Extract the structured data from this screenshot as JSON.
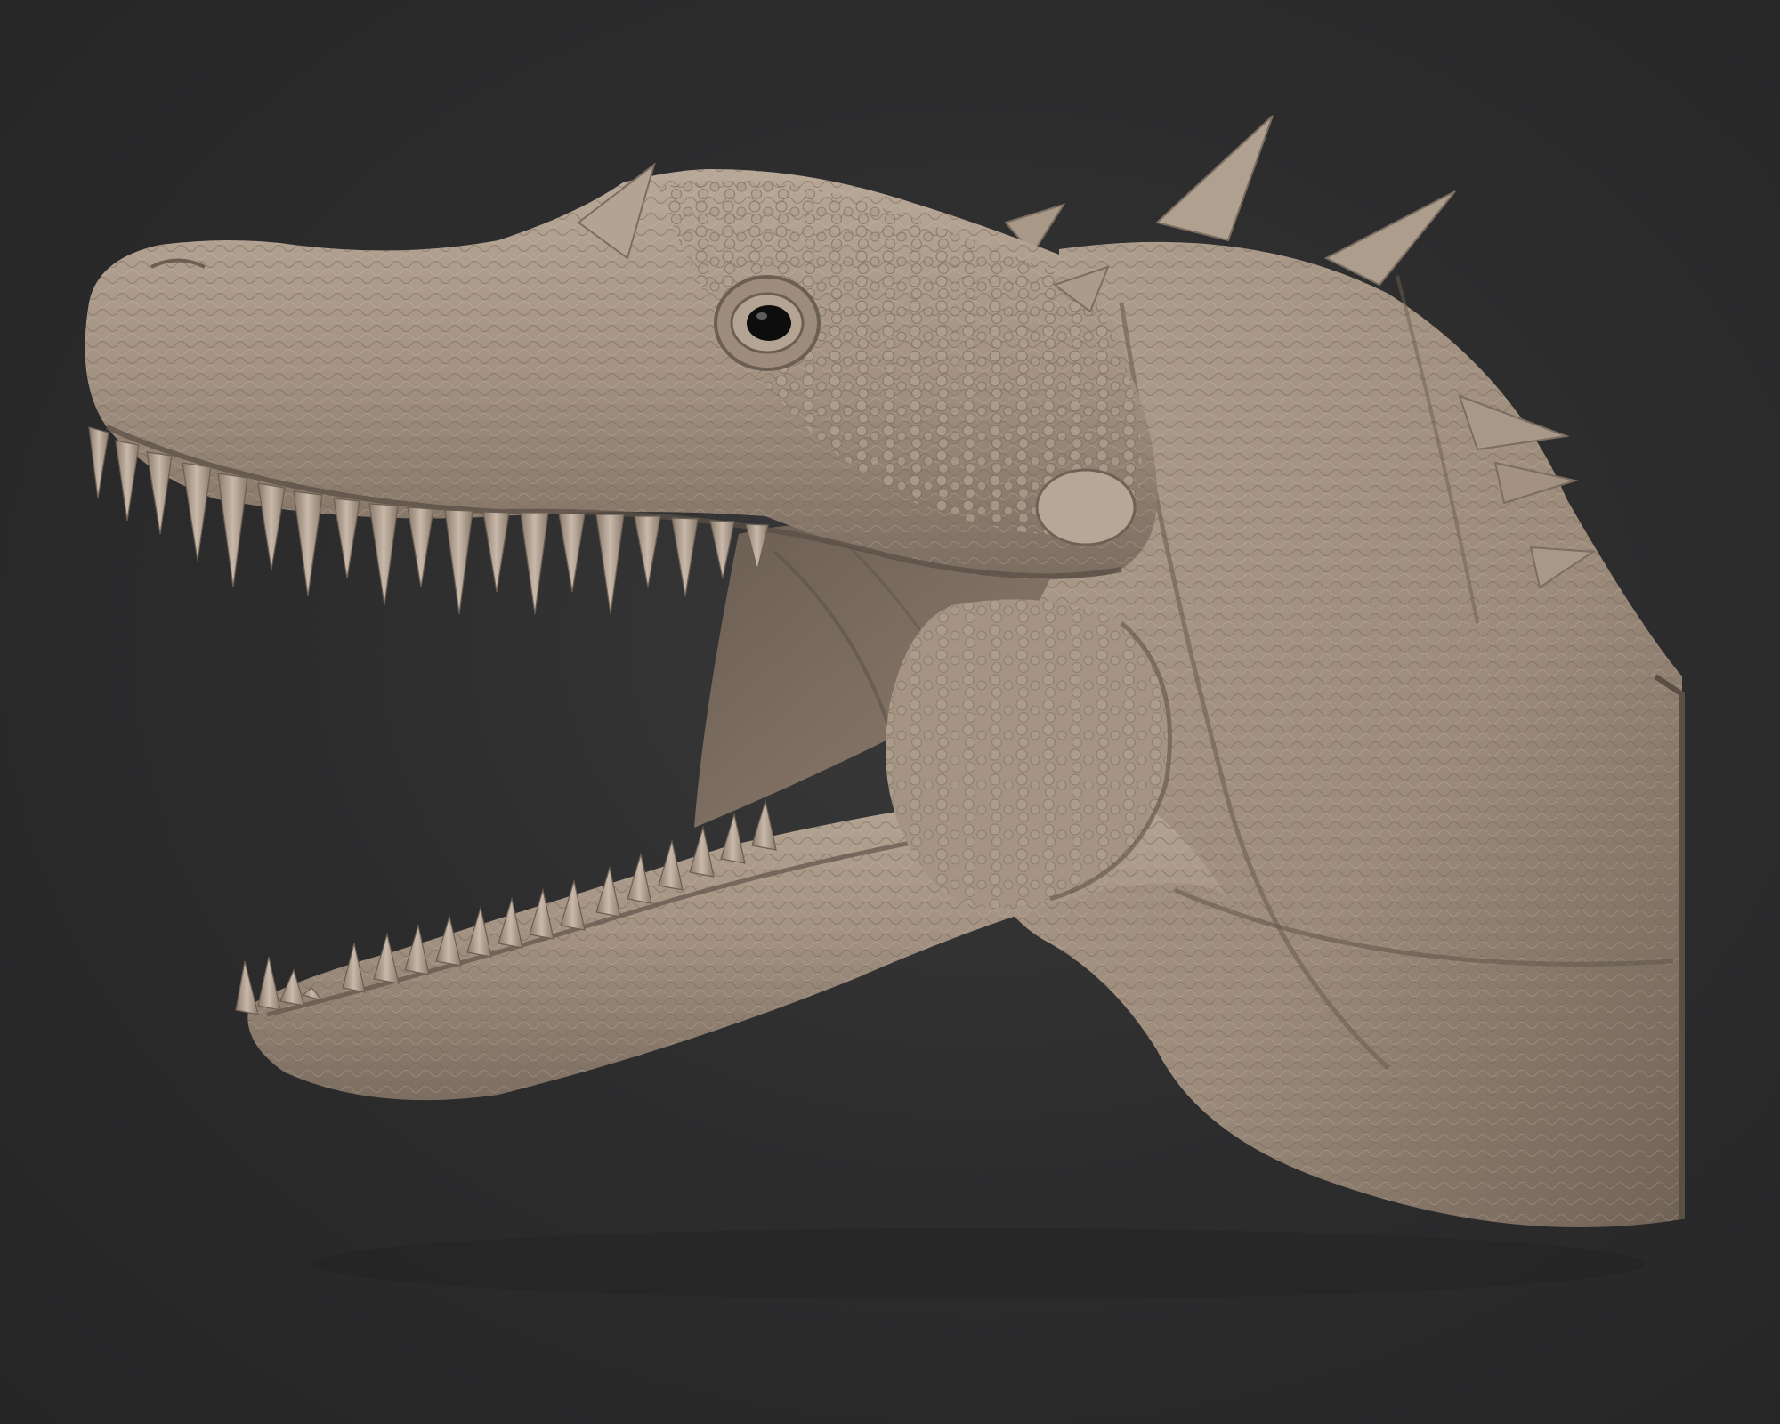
{
  "scene": {
    "background_color": "#2d2d2e",
    "model_color": "#a39282",
    "model_shadow_color": "#6e6155",
    "model_highlight_color": "#c7b8a8",
    "mouth_interior_color": "#8a7a6c",
    "eye_color": "#0d0d0d"
  }
}
